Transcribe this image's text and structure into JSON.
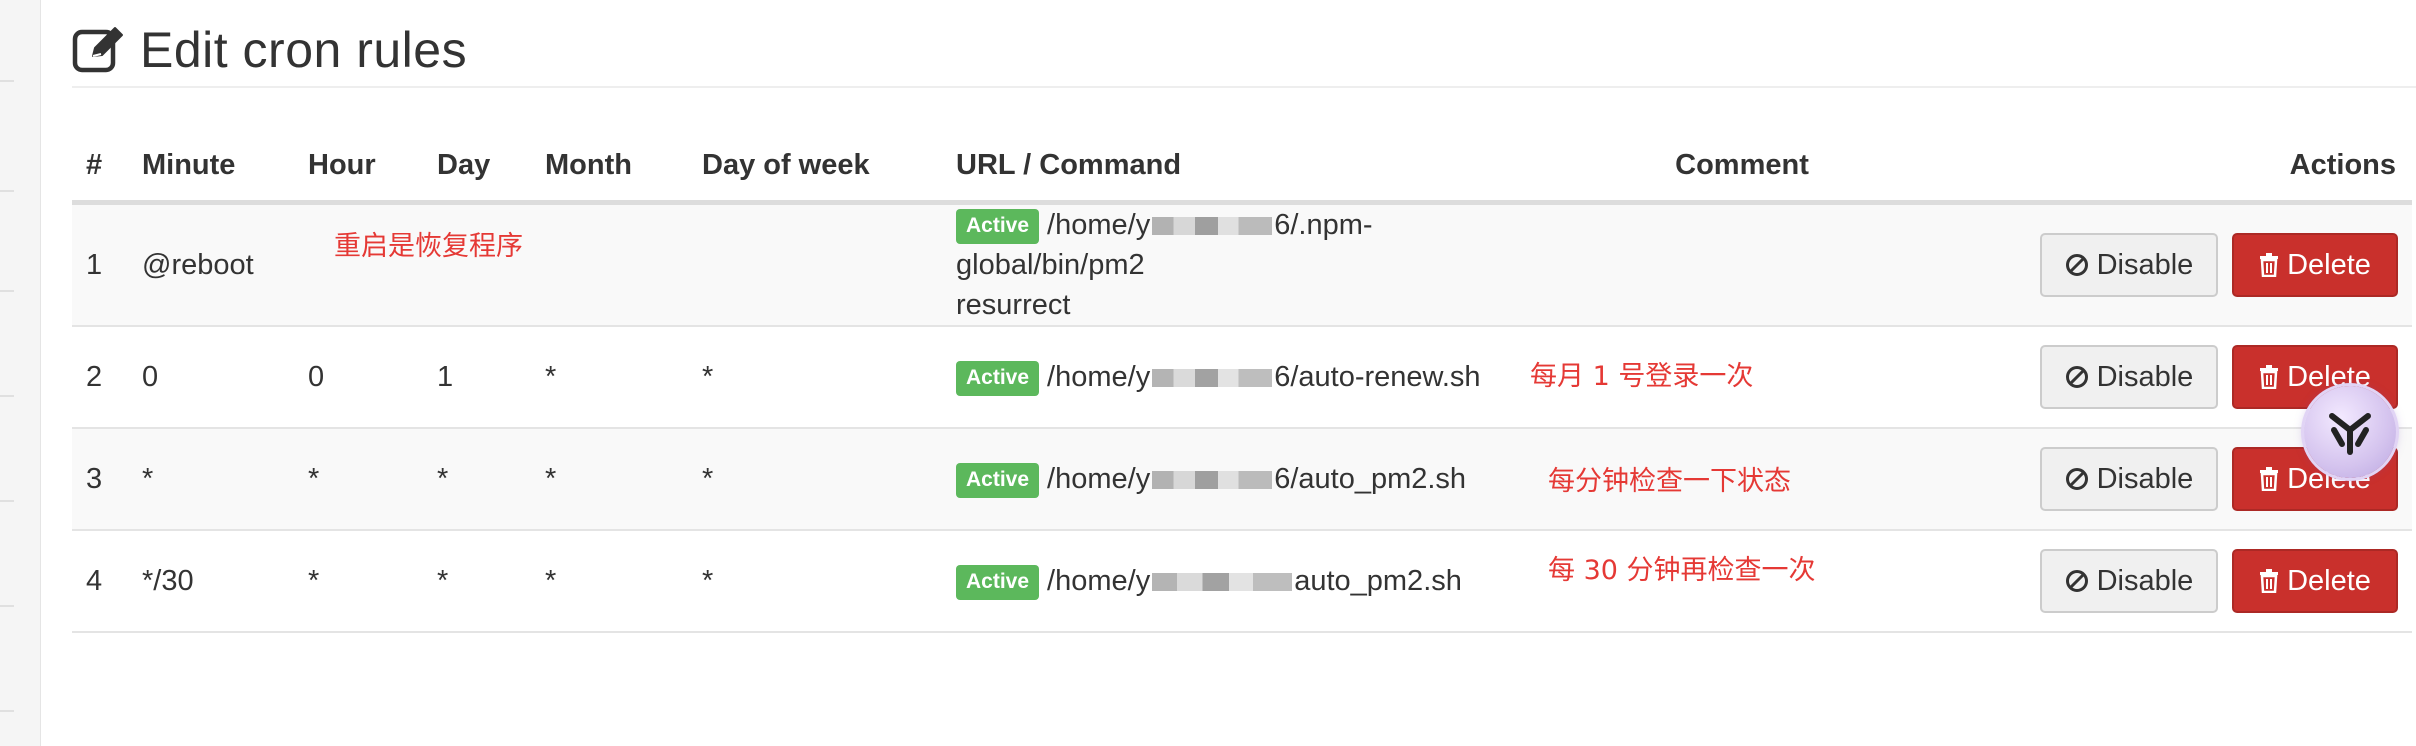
{
  "header": {
    "title": "Edit cron rules",
    "icon": "edit-icon"
  },
  "table": {
    "columns": [
      "#",
      "Minute",
      "Hour",
      "Day",
      "Month",
      "Day of week",
      "URL / Command",
      "Comment",
      "Actions"
    ],
    "rows": [
      {
        "num": "1",
        "minute": "@reboot",
        "hour": "",
        "day": "",
        "month": "",
        "dow": "",
        "status": "Active",
        "cmd_start": "/home/y",
        "cmd_end": "6/.npm-global/bin/pm2",
        "cmd_line2": "resurrect",
        "comment": ""
      },
      {
        "num": "2",
        "minute": "0",
        "hour": "0",
        "day": "1",
        "month": "*",
        "dow": "*",
        "status": "Active",
        "cmd_start": "/home/y",
        "cmd_end": "6/auto-renew.sh",
        "comment": ""
      },
      {
        "num": "3",
        "minute": "*",
        "hour": "*",
        "day": "*",
        "month": "*",
        "dow": "*",
        "status": "Active",
        "cmd_start": "/home/y",
        "cmd_end": "6/auto_pm2.sh",
        "comment": ""
      },
      {
        "num": "4",
        "minute": "*/30",
        "hour": "*",
        "day": "*",
        "month": "*",
        "dow": "*",
        "status": "Active",
        "cmd_start": "/home/y",
        "cmd_end": "auto_pm2.sh",
        "comment": ""
      }
    ]
  },
  "buttons": {
    "disable_label": "Disable",
    "delete_label": "Delete"
  },
  "annotations": {
    "row1": "重启是恢复程序",
    "row2": "每月 1 号登录一次",
    "row3": "每分钟检查一下状态",
    "row4": "每 30 分钟再检查一次"
  },
  "colors": {
    "active_badge": "#5cb85c",
    "delete_button": "#c9302c",
    "annotation_text": "#e53935"
  }
}
